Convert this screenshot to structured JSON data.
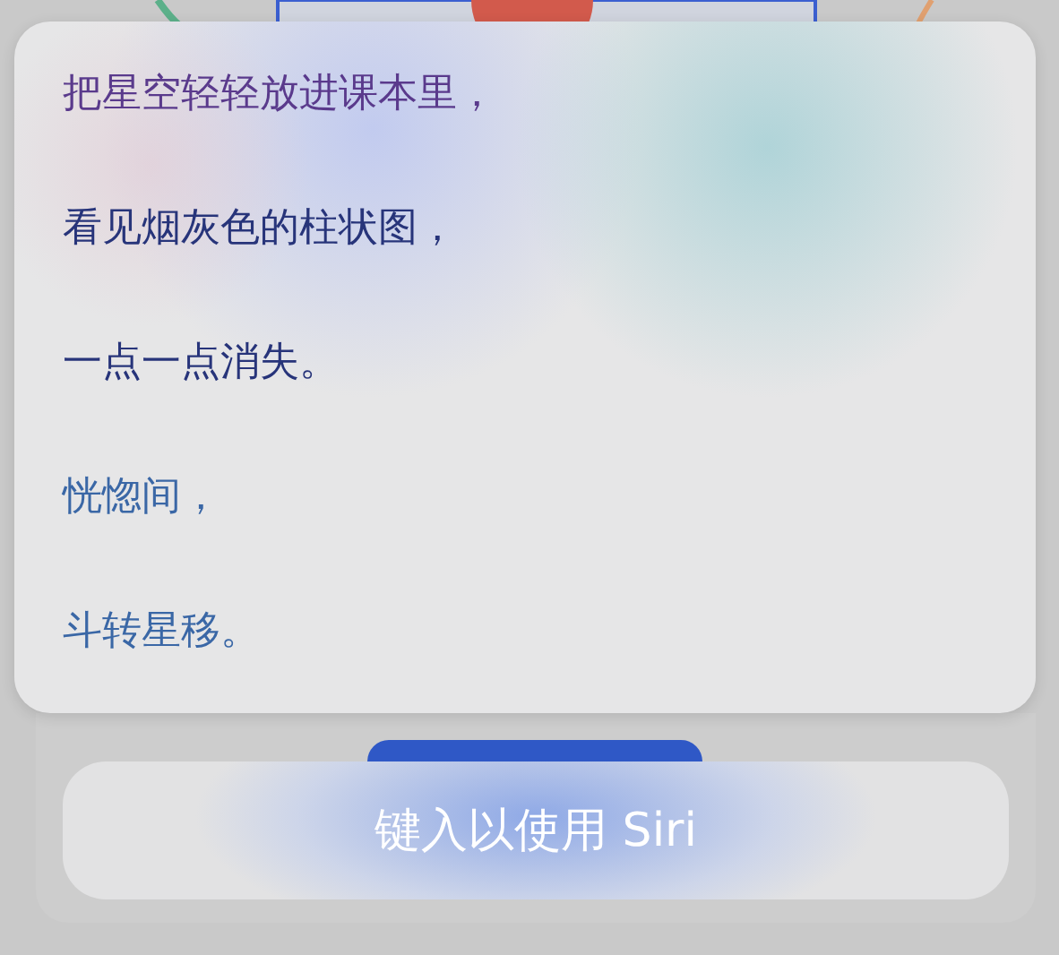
{
  "lyrics": [
    {
      "text": "把星空轻轻放进课本里，",
      "color": "#5a3a8c"
    },
    {
      "text": "看见烟灰色的柱状图，",
      "color": "#27347a"
    },
    {
      "text": "一点一点消失。",
      "color": "#27347a"
    },
    {
      "text": "恍惚间，",
      "color": "#3a67a6"
    },
    {
      "text": "斗转星移。",
      "color": "#3a67a6"
    }
  ],
  "siri_field": {
    "placeholder": "键入以使用 Siri"
  }
}
